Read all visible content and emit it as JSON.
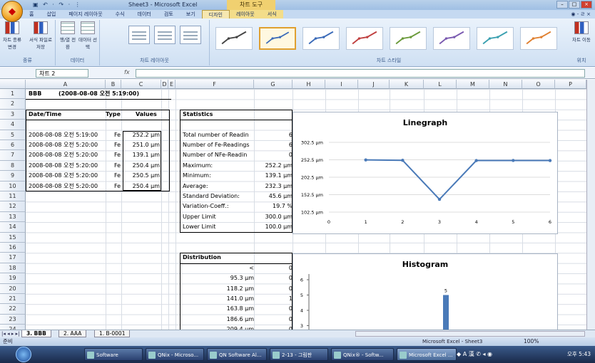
{
  "window": {
    "title": "Sheet3 - Microsoft Excel",
    "context_tools": "차트 도구",
    "quick_access": "▣ ↶ · ↷ · ⋮"
  },
  "tabs": [
    "홈",
    "삽입",
    "페이지 레이아웃",
    "수식",
    "데이터",
    "검토",
    "보기",
    "디자인",
    "레이아웃",
    "서식"
  ],
  "tab_right": "◉ - ㄹ ×",
  "ribbon": {
    "group_type": {
      "label": "종류",
      "btn1": "차트 종류 변경",
      "btn2": "서식 파일로 저장"
    },
    "group_data": {
      "label": "데이터",
      "btn1": "행/열 전환",
      "btn2": "데이터 선택"
    },
    "group_layout": {
      "label": "차트 레이아웃"
    },
    "group_styles": {
      "label": "차트 스타일"
    },
    "group_location": {
      "label": "위치",
      "btn": "차트 이동"
    }
  },
  "formula_bar": {
    "name_box": "차트 2",
    "fx": "fx",
    "value": ""
  },
  "columns": [
    "A",
    "B",
    "C",
    "D",
    "E",
    "F",
    "G",
    "H",
    "I",
    "J",
    "K",
    "L",
    "M",
    "N",
    "O",
    "P"
  ],
  "rows": [
    "1",
    "2",
    "3",
    "4",
    "5",
    "6",
    "7",
    "8",
    "9",
    "10",
    "11",
    "12",
    "13",
    "14",
    "15",
    "16",
    "17",
    "18",
    "19",
    "20",
    "21",
    "22",
    "23",
    "24"
  ],
  "sheet": {
    "header": {
      "name": "BBB",
      "timestamp": "(2008-08-08 오전 5:19:00)"
    },
    "table_headers": {
      "datetime": "Date/Time",
      "type": "Type",
      "values": "Values"
    },
    "readings": [
      {
        "datetime": "2008-08-08 오전 5:19:00",
        "type": "Fe",
        "value": "252.2 µm"
      },
      {
        "datetime": "2008-08-08 오전 5:20:00",
        "type": "Fe",
        "value": "251.0 µm"
      },
      {
        "datetime": "2008-08-08 오전 5:20:00",
        "type": "Fe",
        "value": "139.1 µm"
      },
      {
        "datetime": "2008-08-08 오전 5:20:00",
        "type": "Fe",
        "value": "250.4 µm"
      },
      {
        "datetime": "2008-08-08 오전 5:20:00",
        "type": "Fe",
        "value": "250.5 µm"
      },
      {
        "datetime": "2008-08-08 오전 5:20:00",
        "type": "Fe",
        "value": "250.4 µm"
      }
    ],
    "statistics": {
      "title": "Statistics",
      "rows": [
        {
          "label": "Total number of Readin",
          "value": "6"
        },
        {
          "label": "Number of Fe-Readings",
          "value": "6"
        },
        {
          "label": "Number of NFe-Readin",
          "value": "0"
        },
        {
          "label": "Maximum:",
          "value": "252.2 µm"
        },
        {
          "label": "Minimum:",
          "value": "139.1 µm"
        },
        {
          "label": "Average:",
          "value": "232.3 µm"
        },
        {
          "label": "Standard Deviation:",
          "value": "45.6 µm"
        },
        {
          "label": "Variation-Coeff.:",
          "value": "19.7 %"
        },
        {
          "label": "Upper Limit",
          "value": "300.0 µm"
        },
        {
          "label": "Lower Limit",
          "value": "100.0 µm"
        }
      ]
    },
    "distribution": {
      "title": "Distribution",
      "rows": [
        {
          "label": "<",
          "value": "0"
        },
        {
          "label": "95.3 µm",
          "value": "0"
        },
        {
          "label": "118.2 µm",
          "value": "0"
        },
        {
          "label": "141.0 µm",
          "value": "1"
        },
        {
          "label": "163.8 µm",
          "value": "0"
        },
        {
          "label": "186.6 µm",
          "value": "0"
        },
        {
          "label": "209.4 µm",
          "value": "0"
        }
      ]
    }
  },
  "chart_data": [
    {
      "type": "line",
      "title": "Linegraph",
      "x": [
        1,
        2,
        3,
        4,
        5,
        6
      ],
      "x_ticks": [
        "0",
        "1",
        "2",
        "3",
        "4",
        "5",
        "6"
      ],
      "y_ticks": [
        "302.5 µm",
        "252.5 µm",
        "202.5 µm",
        "152.5 µm",
        "102.5 µm"
      ],
      "ylim": [
        102.5,
        302.5
      ],
      "xlim": [
        0,
        6
      ],
      "series": [
        {
          "values": [
            252.2,
            251.0,
            139.1,
            250.4,
            250.5,
            250.4
          ],
          "color": "#4a7ab8"
        }
      ],
      "grid": true
    },
    {
      "type": "bar",
      "title": "Histogram",
      "y_ticks": [
        "6",
        "5",
        "4",
        "3"
      ],
      "bar_value": 5,
      "bar_label": "5",
      "color": "#4a7ab8"
    }
  ],
  "sheet_tabs": [
    "3. BBB",
    "2. AAA",
    "1. B-0001"
  ],
  "status": {
    "ready": "준비",
    "views": "Microsoft Excel - Sheet3",
    "zoom": "100%"
  },
  "taskbar": {
    "items": [
      "Software",
      "QNix - Microso...",
      "QN Software Al...",
      "2-13 - 그림판",
      "QNix® - Softw...",
      "Microsoft Excel ..."
    ],
    "tray": "◆ A 漢 ✆ ◂ ◉",
    "clock": "오후 5:43"
  }
}
